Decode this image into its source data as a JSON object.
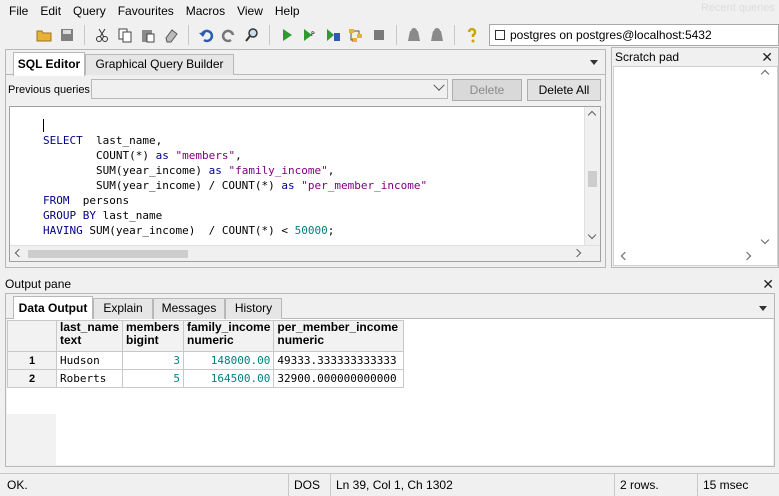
{
  "menu": [
    "File",
    "Edit",
    "Query",
    "Favourites",
    "Macros",
    "View",
    "Help"
  ],
  "ghost_title": "Recent queries",
  "toolbar": {
    "icons": [
      "open-file-icon",
      "save-icon",
      "cut-icon",
      "copy-icon",
      "paste-icon",
      "clear-icon",
      "undo-icon",
      "redo-icon",
      "find-icon",
      "execute-icon",
      "execute-pgscript-icon",
      "execute-to-file-icon",
      "explain-icon",
      "cancel-query-icon",
      "explain-analyze-icon",
      "history-icon",
      "help-icon"
    ],
    "connection": "postgres on postgres@localhost:5432"
  },
  "editor": {
    "tabs": [
      "SQL Editor",
      "Graphical Query Builder"
    ],
    "previous_queries_label": "Previous queries",
    "delete_label": "Delete",
    "delete_all_label": "Delete All",
    "sql_lines": [
      [],
      [
        {
          "t": "kw",
          "v": "SELECT"
        },
        {
          "t": "plain",
          "v": "  last_name,"
        }
      ],
      [
        {
          "t": "plain",
          "v": "        COUNT(*) "
        },
        {
          "t": "kw",
          "v": "as"
        },
        {
          "t": "str",
          "v": " \"members\""
        },
        {
          "t": "plain",
          "v": ","
        }
      ],
      [
        {
          "t": "plain",
          "v": "        SUM(year_income) "
        },
        {
          "t": "kw",
          "v": "as"
        },
        {
          "t": "str",
          "v": " \"family_income\""
        },
        {
          "t": "plain",
          "v": ","
        }
      ],
      [
        {
          "t": "plain",
          "v": "        SUM(year_income) / COUNT(*) "
        },
        {
          "t": "kw",
          "v": "as"
        },
        {
          "t": "str",
          "v": " \"per_member_income\""
        }
      ],
      [
        {
          "t": "kw",
          "v": "FROM"
        },
        {
          "t": "plain",
          "v": "  persons"
        }
      ],
      [
        {
          "t": "kw",
          "v": "GROUP BY"
        },
        {
          "t": "plain",
          "v": " last_name"
        }
      ],
      [
        {
          "t": "kw",
          "v": "HAVING"
        },
        {
          "t": "plain",
          "v": " SUM(year_income)  / COUNT(*) < "
        },
        {
          "t": "num",
          "v": "50000"
        },
        {
          "t": "plain",
          "v": ";"
        }
      ]
    ]
  },
  "scratch_pad": {
    "title": "Scratch pad"
  },
  "output": {
    "title": "Output pane",
    "tabs": [
      "Data Output",
      "Explain",
      "Messages",
      "History"
    ],
    "columns": [
      {
        "name": "last_name",
        "type": "text"
      },
      {
        "name": "members",
        "type": "bigint"
      },
      {
        "name": "family_income",
        "type": "numeric"
      },
      {
        "name": "per_member_income",
        "type": "numeric"
      }
    ],
    "rows": [
      {
        "num": "1",
        "cells": [
          "Hudson",
          "3",
          "148000.00",
          "49333.333333333333"
        ]
      },
      {
        "num": "2",
        "cells": [
          "Roberts",
          "5",
          "164500.00",
          "32900.000000000000"
        ]
      }
    ]
  },
  "status": {
    "message": "OK.",
    "line_ending": "DOS",
    "position": "Ln 39, Col 1, Ch 1302",
    "rows": "2 rows.",
    "time": "15 msec"
  },
  "colors": {
    "keyword": "#00008b",
    "string": "#800080",
    "number": "#008080"
  }
}
